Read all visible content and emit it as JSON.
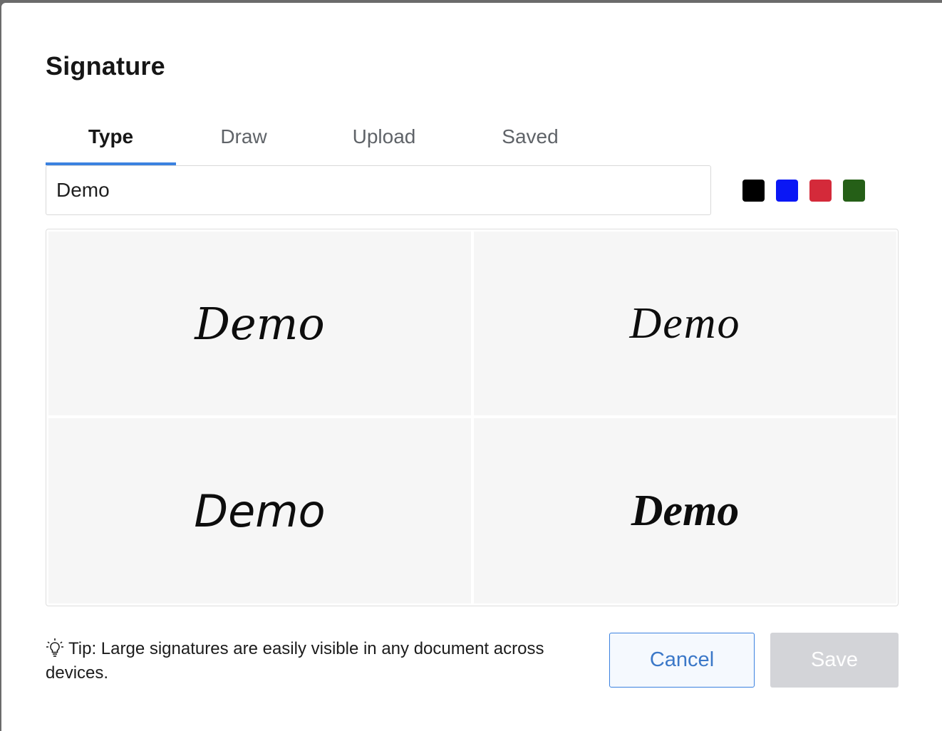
{
  "dialog": {
    "title": "Signature"
  },
  "tabs": [
    {
      "label": "Type",
      "active": true
    },
    {
      "label": "Draw",
      "active": false
    },
    {
      "label": "Upload",
      "active": false
    },
    {
      "label": "Saved",
      "active": false
    }
  ],
  "name_input": {
    "value": "Demo",
    "placeholder": ""
  },
  "colors": [
    {
      "name": "black",
      "hex": "#000000"
    },
    {
      "name": "blue",
      "hex": "#0a17f5"
    },
    {
      "name": "red",
      "hex": "#d42a3a"
    },
    {
      "name": "green",
      "hex": "#255f17"
    }
  ],
  "signature_options": [
    {
      "text": "Demo",
      "style": "script-1"
    },
    {
      "text": "Demo",
      "style": "script-2"
    },
    {
      "text": "Demo",
      "style": "script-3"
    },
    {
      "text": "Demo",
      "style": "script-4"
    }
  ],
  "tip": {
    "icon": "lightbulb-icon",
    "text": "Tip: Large signatures are easily visible in any document across devices."
  },
  "buttons": {
    "cancel_label": "Cancel",
    "save_label": "Save",
    "save_disabled": true
  },
  "accent_color": "#3b82e0"
}
